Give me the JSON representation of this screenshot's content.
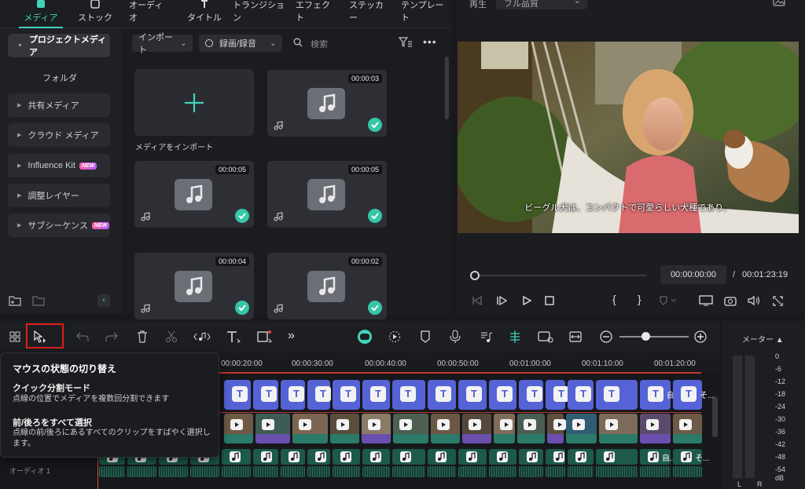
{
  "tabs": [
    {
      "label": "メディア",
      "icon": "media-icon",
      "active": true
    },
    {
      "label": "ストック",
      "icon": "stock-icon"
    },
    {
      "label": "オーディオ",
      "icon": "audio-icon"
    },
    {
      "label": "タイトル",
      "icon": "title-icon"
    },
    {
      "label": "トランジション",
      "icon": "transition-icon"
    },
    {
      "label": "エフェクト",
      "icon": "effect-icon"
    },
    {
      "label": "ステッカー",
      "icon": "sticker-icon"
    },
    {
      "label": "テンプレート",
      "icon": "template-icon"
    }
  ],
  "sidebar": {
    "project_media": "プロジェクトメディア",
    "folder": "フォルダ",
    "items": [
      {
        "label": "共有メディア"
      },
      {
        "label": "クラウド メディア"
      },
      {
        "label": "Influence Kit",
        "badge": "NEW"
      },
      {
        "label": "調整レイヤー"
      },
      {
        "label": "サブシーケンス",
        "badge": "NEW"
      }
    ]
  },
  "media": {
    "import_btn": "インポート",
    "record_btn": "録画/録音",
    "search_placeholder": "検索",
    "import_label": "メディアをインポート",
    "items": [
      {
        "duration": "00:00:03",
        "checked": true
      },
      {
        "duration": "00:00:05",
        "checked": true
      },
      {
        "duration": "00:00:05",
        "checked": true
      },
      {
        "duration": "00:00:04",
        "checked": true
      },
      {
        "duration": "00:00:02",
        "checked": true
      }
    ]
  },
  "preview": {
    "play_label": "再生",
    "quality": "フル品質",
    "subtitle": "ビーグル犬は、コンパクトで可愛らしい犬種であり、",
    "current_time": "00:00:00:00",
    "separator": "/",
    "total_time": "00:01:23:19"
  },
  "timeline": {
    "ticks": [
      "00:00:20:00",
      "00:00:30:00",
      "00:00:40:00",
      "00:00:50:00",
      "00:01:00:00",
      "00:01:10:00",
      "00:01:20:00"
    ],
    "title_clip_labels": [
      "自...",
      "そ..."
    ],
    "audio_clip_labels": [
      "自...",
      "そ..."
    ],
    "audio_track_label": "オーディオ 1"
  },
  "meter": {
    "title": "メーター ▲",
    "scale": [
      "0",
      "-6",
      "-12",
      "-18",
      "-24",
      "-30",
      "-36",
      "-42",
      "-48",
      "-54"
    ],
    "unit": "dB",
    "left": "L",
    "right": "R"
  },
  "tooltip": {
    "title": "マウスの状態の切り替え",
    "sec1_title": "クイック分割モード",
    "sec1_body": "点線の位置でメディアを複数回分割できます",
    "sec2_title": "前/後ろをすべて選択",
    "sec2_body": "点線の前/後ろにあるすべてのクリップをすばやく選択します。"
  }
}
